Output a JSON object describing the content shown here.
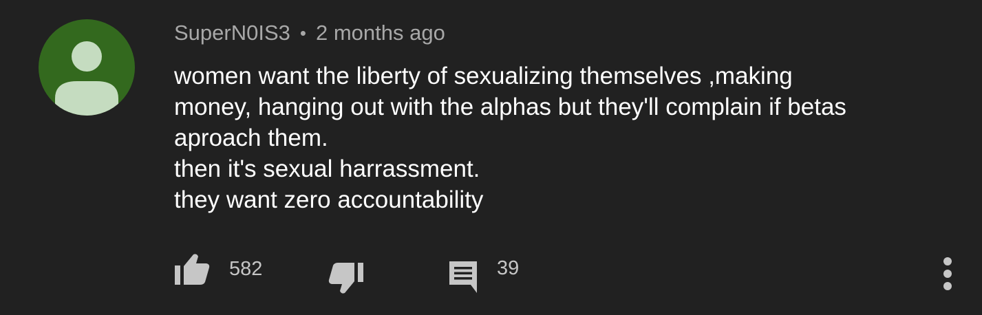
{
  "comment": {
    "author": "SuperN0IS3",
    "separator": "•",
    "time_ago": "2 months ago",
    "text_lines": [
      "women want the liberty of sexualizing themselves ,making",
      "money, hanging out with the alphas but they'll complain if betas",
      "aproach them.",
      "then it's sexual harrassment.",
      "they want zero accountability"
    ]
  },
  "actions": {
    "like_count": "582",
    "reply_count": "39"
  },
  "icons": {
    "avatar": "default-user-avatar-icon",
    "like": "thumbs-up-icon",
    "dislike": "thumbs-down-icon",
    "reply": "comment-icon",
    "more": "more-vertical-icon"
  },
  "colors": {
    "background": "#212121",
    "avatar_bg": "#33691e",
    "avatar_figure": "#c5dcc0",
    "text": "#ffffff",
    "meta_text": "#a8a8a8",
    "icon": "#c6c6c6"
  }
}
